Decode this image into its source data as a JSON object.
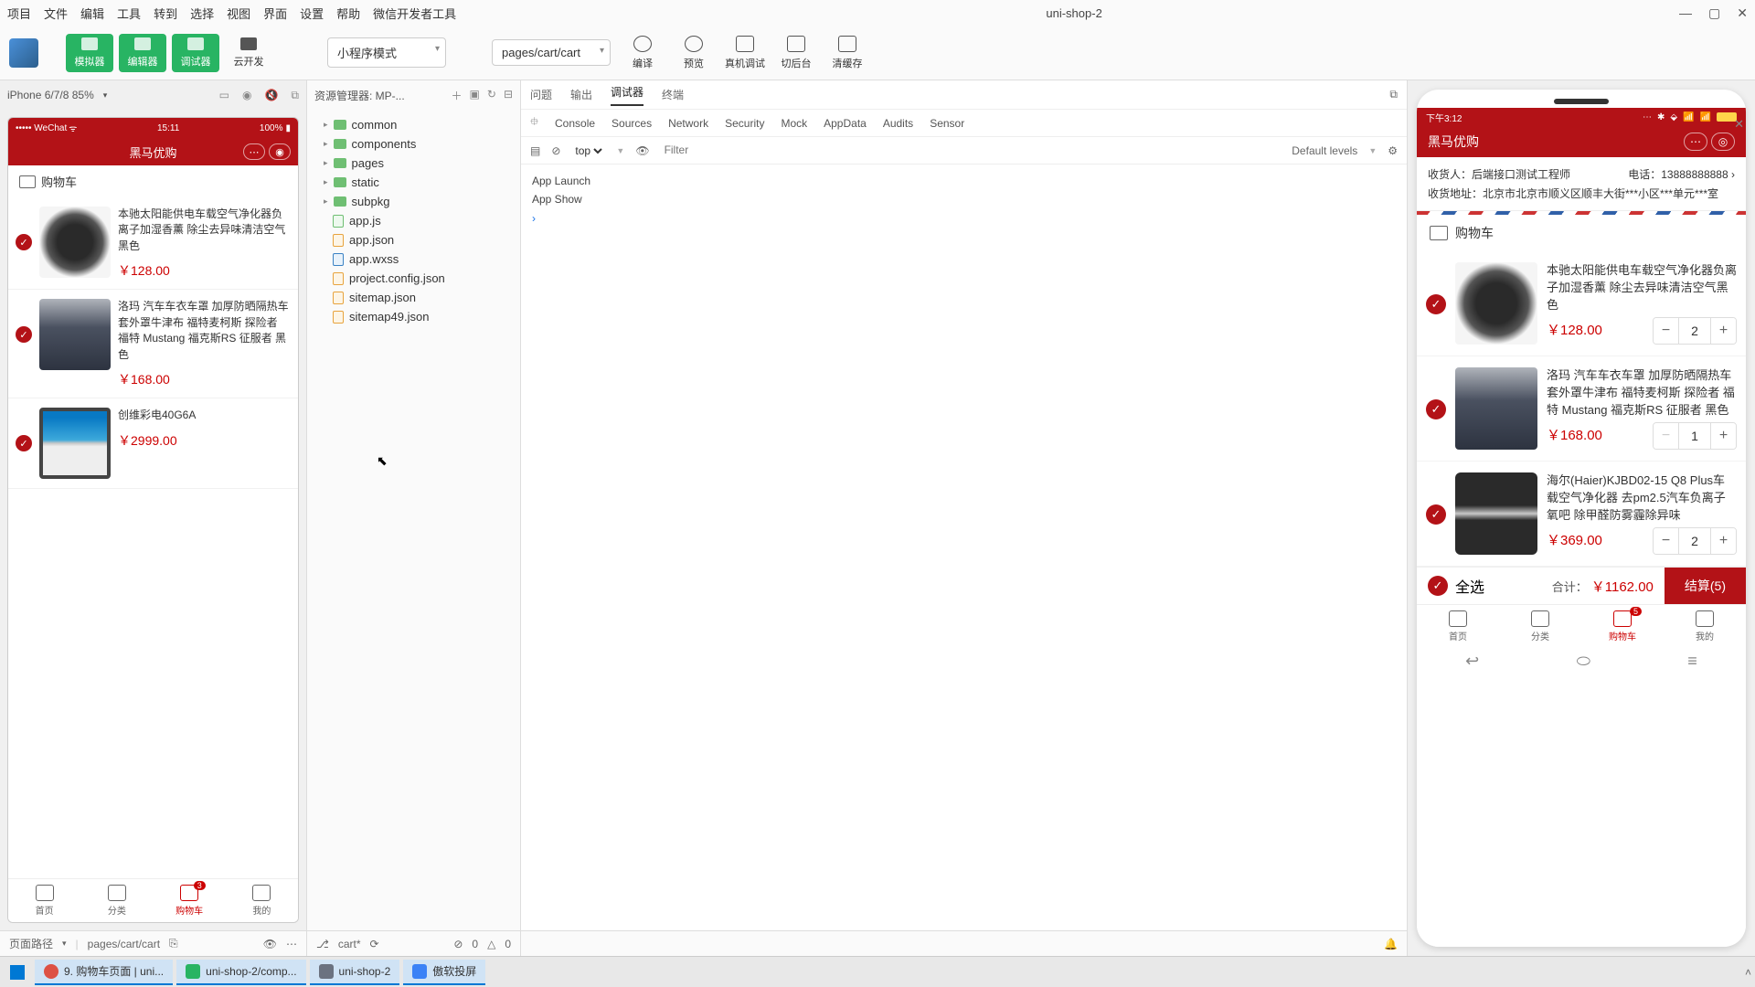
{
  "menubar": {
    "items": [
      "项目",
      "文件",
      "编辑",
      "工具",
      "转到",
      "选择",
      "视图",
      "界面",
      "设置",
      "帮助",
      "微信开发者工具"
    ],
    "title": "uni-shop-2",
    "win_min": "—",
    "win_max": "▢",
    "win_close": "✕"
  },
  "toolbar": {
    "simulator": "模拟器",
    "editor": "编辑器",
    "debugger": "调试器",
    "cloud": "云开发",
    "mode": "小程序模式",
    "page": "pages/cart/cart",
    "compile": "编译",
    "preview": "预览",
    "remote": "真机调试",
    "background": "切后台",
    "cache": "清缓存"
  },
  "simulator": {
    "device": "iPhone 6/7/8 85%",
    "status_left": "••••• WeChat",
    "status_time": "15:11",
    "status_right": "100%",
    "header": "黑马优购",
    "cart_label": "购物车",
    "items": [
      {
        "title": "本驰太阳能供电车载空气净化器负离子加湿香薰 除尘去异味清洁空气黑色",
        "price": "￥128.00"
      },
      {
        "title": "洛玛 汽车车衣车罩 加厚防晒隔热车套外罩牛津布 福特麦柯斯 探险者 福特 Mustang 福克斯RS 征服者 黑色",
        "price": "￥168.00"
      },
      {
        "title": "创维彩电40G6A",
        "price": "￥2999.00"
      }
    ],
    "tabs": [
      "首页",
      "分类",
      "购物车",
      "我的"
    ],
    "badge": "3"
  },
  "explorer": {
    "label": "资源管理器: MP-...",
    "folders": [
      "common",
      "components",
      "pages",
      "static",
      "subpkg"
    ],
    "files": [
      "app.js",
      "app.json",
      "app.wxss",
      "project.config.json",
      "sitemap.json",
      "sitemap49.json"
    ]
  },
  "debugger": {
    "tabs1": [
      "问题",
      "输出",
      "调试器",
      "终端"
    ],
    "tabs2": [
      "Console",
      "Sources",
      "Network",
      "Security",
      "Mock",
      "AppData",
      "Audits",
      "Sensor"
    ],
    "context": "top",
    "filter_ph": "Filter",
    "levels": "Default levels",
    "log1": "App Launch",
    "log2": "App Show",
    "prompt": "›"
  },
  "preview": {
    "time": "下午3:12",
    "title": "黑马优购",
    "close": "✕",
    "addr_name_lbl": "收货人：",
    "addr_name": "后端接口测试工程师",
    "phone_lbl": "电话：",
    "phone": "13888888888",
    "addr_lbl": "收货地址：",
    "addr": "北京市北京市顺义区顺丰大街***小区***单元***室",
    "cart_label": "购物车",
    "items": [
      {
        "title": "本驰太阳能供电车载空气净化器负离子加湿香薰 除尘去异味清洁空气黑色",
        "price": "￥128.00",
        "qty": "2"
      },
      {
        "title": "洛玛 汽车车衣车罩 加厚防晒隔热车套外罩牛津布 福特麦柯斯 探险者 福特 Mustang 福克斯RS 征服者 黑色",
        "price": "￥168.00",
        "qty": "1"
      },
      {
        "title": "海尔(Haier)KJBD02-15 Q8 Plus车载空气净化器 去pm2.5汽车负离子氧吧 除甲醛防雾霾除异味",
        "price": "￥369.00",
        "qty": "2"
      }
    ],
    "select_all": "全选",
    "total_lbl": "合计：",
    "total": "￥1162.00",
    "checkout": "结算(5)",
    "tabs": [
      "首页",
      "分类",
      "购物车",
      "我的"
    ],
    "badge": "5"
  },
  "statusbar": {
    "path_label": "页面路径",
    "path": "pages/cart/cart",
    "branch": "cart*",
    "err": "0",
    "warn": "0"
  },
  "taskbar": {
    "items": [
      {
        "label": "9. 购物车页面 | uni...",
        "color": "#dd5144"
      },
      {
        "label": "uni-shop-2/comp...",
        "color": "#28b463"
      },
      {
        "label": "uni-shop-2",
        "color": "#6b7280"
      },
      {
        "label": "傲软投屏",
        "color": "#3b82f6"
      }
    ]
  }
}
